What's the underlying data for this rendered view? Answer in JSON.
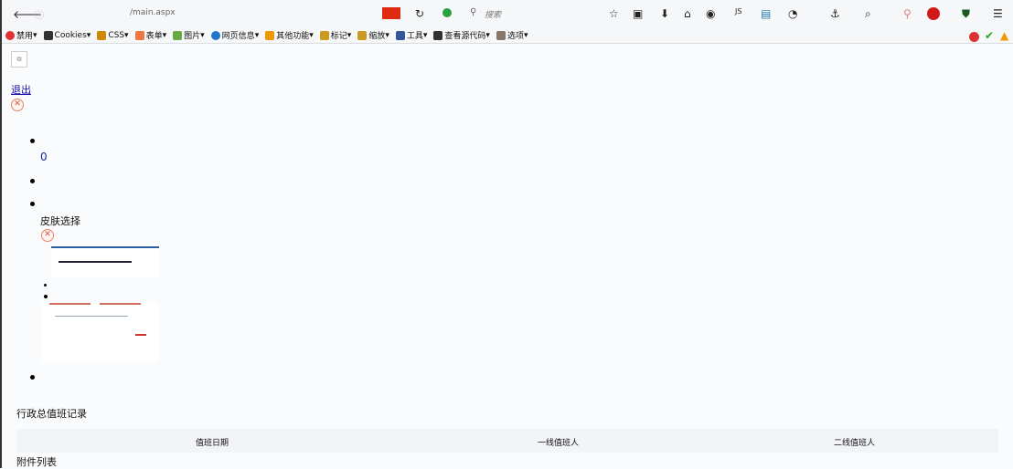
{
  "browser": {
    "url": "/main.aspx",
    "search_placeholder": "搜索"
  },
  "devtoolbar": {
    "items": [
      "禁用",
      "Cookies",
      "CSS",
      "表单",
      "图片",
      "网页信息",
      "其他功能",
      "标记",
      "缩放",
      "工具",
      "查看源代码",
      "选项"
    ]
  },
  "page": {
    "logout_link": "退出",
    "count": "0",
    "skin_label": "皮肤选择",
    "section_title": "行政总值班记录",
    "table_headers": [
      "值班日期",
      "一线值班人",
      "二线值班人"
    ],
    "attachments_label": "附件列表"
  }
}
